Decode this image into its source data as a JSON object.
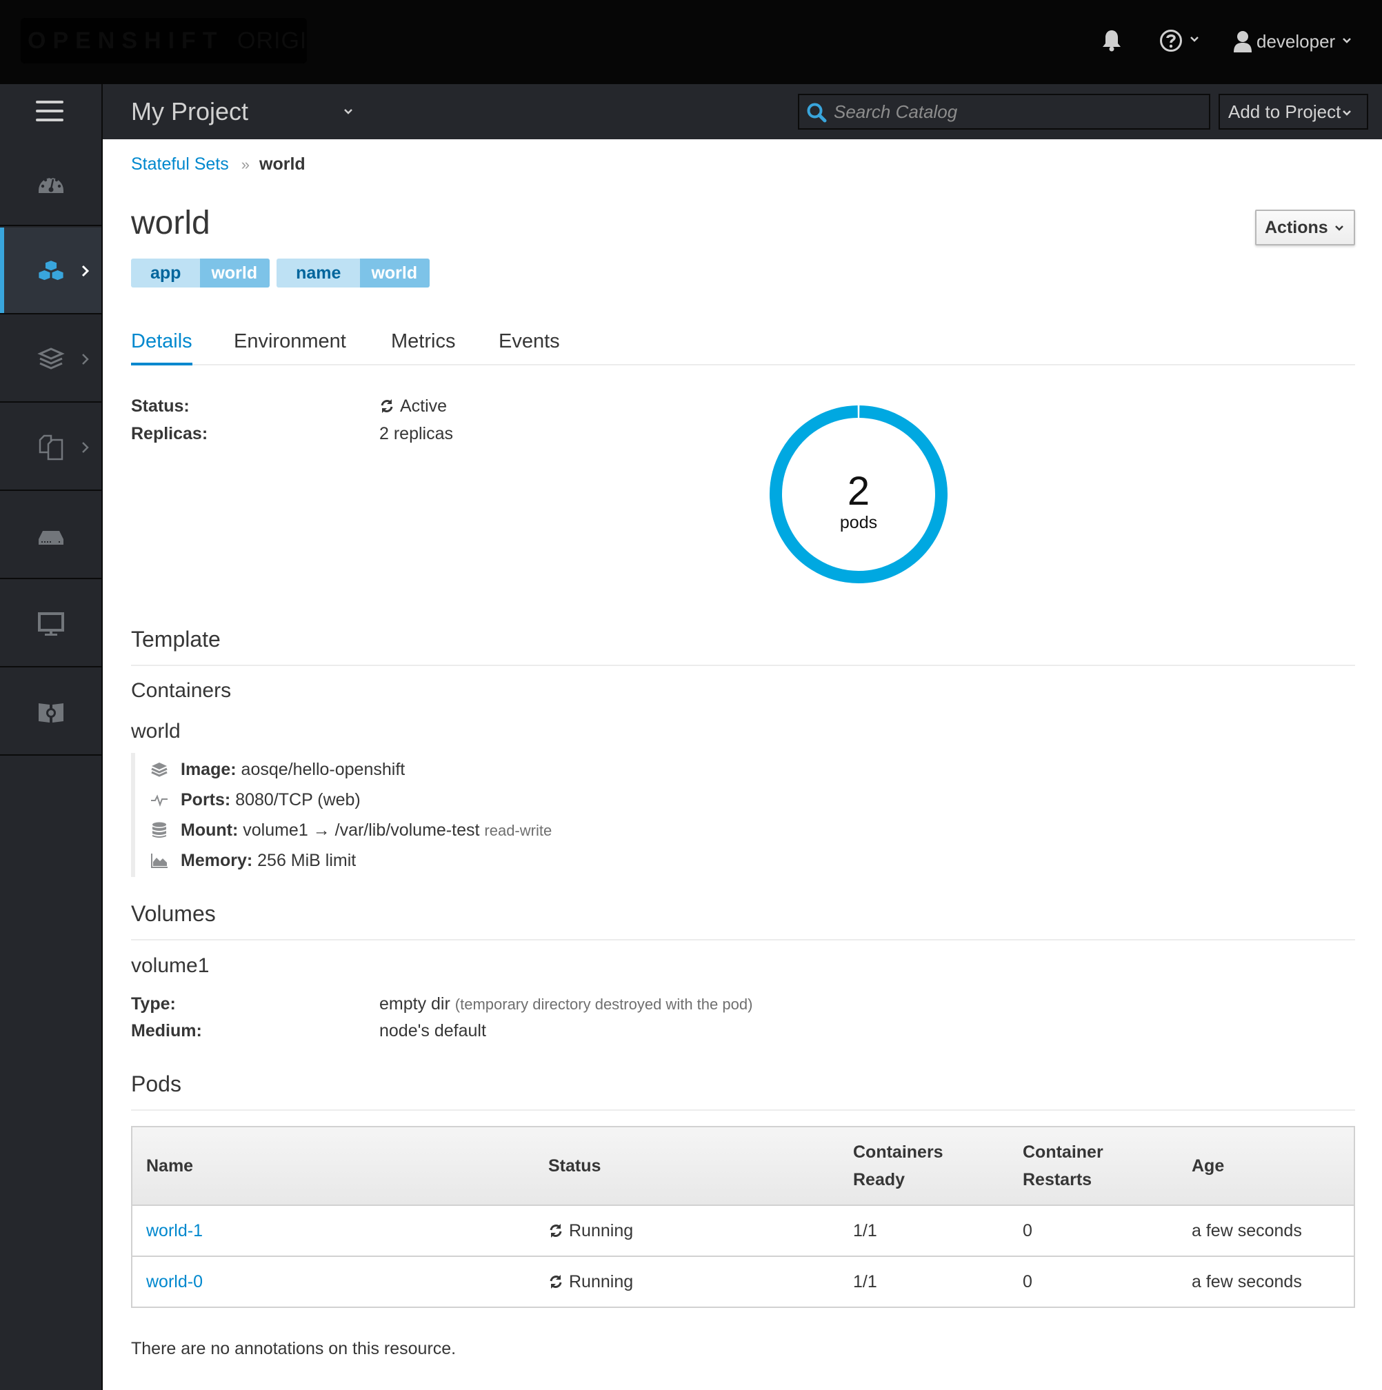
{
  "masthead": {
    "brand_bold": "OPENSHIFT",
    "brand_light": "ORIGIN",
    "notifications_icon": "bell-icon",
    "help_icon": "question-circle-icon",
    "user": {
      "icon": "user-icon",
      "name": "developer"
    }
  },
  "navbar": {
    "menu_icon": "hamburger-icon",
    "project_name": "My Project",
    "search": {
      "icon": "search-icon",
      "placeholder": "Search Catalog",
      "value": ""
    },
    "add_to_project_label": "Add to Project"
  },
  "sidebar": {
    "items": [
      {
        "name": "overview",
        "icon": "dashboard-icon",
        "has_submenu": false,
        "active": false
      },
      {
        "name": "applications",
        "icon": "cubes-icon",
        "has_submenu": true,
        "active": true
      },
      {
        "name": "builds",
        "icon": "layers-icon",
        "has_submenu": true,
        "active": false
      },
      {
        "name": "resources",
        "icon": "files-icon",
        "has_submenu": true,
        "active": false
      },
      {
        "name": "storage",
        "icon": "hard-drive-icon",
        "has_submenu": false,
        "active": false
      },
      {
        "name": "monitoring",
        "icon": "monitor-icon",
        "has_submenu": false,
        "active": false
      },
      {
        "name": "catalog",
        "icon": "book-gear-icon",
        "has_submenu": false,
        "active": false
      }
    ]
  },
  "breadcrumb": {
    "parent": "Stateful Sets",
    "separator": "»",
    "current": "world"
  },
  "page": {
    "title": "world",
    "actions_label": "Actions",
    "labels": [
      {
        "key": "app",
        "value": "world"
      },
      {
        "key": "name",
        "value": "world"
      }
    ],
    "tabs": [
      {
        "label": "Details",
        "active": true
      },
      {
        "label": "Environment",
        "active": false
      },
      {
        "label": "Metrics",
        "active": false
      },
      {
        "label": "Events",
        "active": false
      }
    ]
  },
  "details": {
    "status_label": "Status:",
    "status_value": "Active",
    "replicas_label": "Replicas:",
    "replicas_value": "2 replicas",
    "donut": {
      "count": "2",
      "unit": "pods",
      "color": "#00a8e1",
      "running": 2,
      "total": 2
    }
  },
  "template": {
    "title": "Template",
    "containers_title": "Containers",
    "container": {
      "name": "world",
      "image_label": "Image:",
      "image_value": "aosqe/hello-openshift",
      "ports_label": "Ports:",
      "ports_value": "8080/TCP (web)",
      "mount_label": "Mount:",
      "mount_value": "volume1 → /var/lib/volume-test",
      "mount_mode": "read-write",
      "memory_label": "Memory:",
      "memory_value": "256 MiB limit"
    }
  },
  "volumes": {
    "title": "Volumes",
    "name": "volume1",
    "type_label": "Type:",
    "type_value": "empty dir",
    "type_note": "(temporary directory destroyed with the pod)",
    "medium_label": "Medium:",
    "medium_value": "node's default"
  },
  "pods": {
    "title": "Pods",
    "columns": [
      "Name",
      "Status",
      "Containers Ready",
      "Container Restarts",
      "Age"
    ],
    "rows": [
      {
        "name": "world-1",
        "status": "Running",
        "ready": "1/1",
        "restarts": "0",
        "age": "a few seconds"
      },
      {
        "name": "world-0",
        "status": "Running",
        "ready": "1/1",
        "restarts": "0",
        "age": "a few seconds"
      }
    ]
  },
  "annotations_text": "There are no annotations on this resource."
}
